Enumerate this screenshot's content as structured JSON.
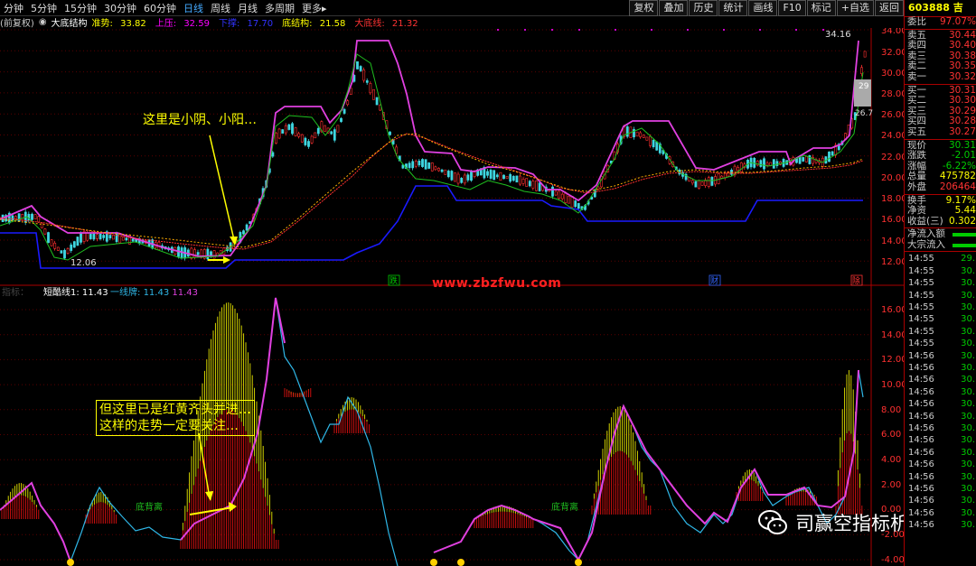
{
  "toolbar": {
    "periods": [
      "分钟",
      "5分钟",
      "15分钟",
      "30分钟",
      "60分钟",
      "日线",
      "周线",
      "月线",
      "多周期",
      "更多"
    ],
    "active_period": "日线",
    "more_arrow": "▸",
    "buttons": [
      "复权",
      "叠加",
      "历史",
      "统计",
      "画线",
      "F10",
      "标记",
      "+自选",
      "返回"
    ]
  },
  "indicator_line": {
    "prefix": "(前复权)",
    "name": "大底结构",
    "items": [
      {
        "label": "准势:",
        "value": "33.82",
        "color": "#ff0"
      },
      {
        "label": "上压:",
        "value": "32.59",
        "color": "#f0f"
      },
      {
        "label": "下撑:",
        "value": "17.70",
        "color": "#33f"
      },
      {
        "label": "底结构:",
        "value": "21.58",
        "color": "#ff0"
      },
      {
        "label": "大底线:",
        "value": "21.32",
        "color": "#f33"
      }
    ]
  },
  "sub_indicator": {
    "prefix": "指标：",
    "label1": "短酷线1:",
    "value1": "11.43",
    "label2": "一线牌:",
    "value2": "11.43",
    "value3": "11.43"
  },
  "main_chart": {
    "y_ticks": [
      "34.00",
      "32.00",
      "30.00",
      "28.00",
      "26.00",
      "24.00",
      "22.00",
      "20.00",
      "18.00",
      "16.00",
      "14.00",
      "12.00"
    ],
    "high_label": "34.16",
    "low_label": "12.06",
    "right_labels": [
      "29",
      "26.7"
    ],
    "event_markers": [
      {
        "text": "跌",
        "color": "#0c0"
      },
      {
        "text": "财",
        "color": "#36f"
      },
      {
        "text": "除",
        "color": "#f33"
      }
    ]
  },
  "sub_chart": {
    "y_ticks": [
      "16.00",
      "14.00",
      "12.00",
      "10.00",
      "8.00",
      "6.00",
      "4.00",
      "2.00",
      "0.00",
      "-2.00",
      "-4.00"
    ],
    "labels": [
      "底背离",
      "底背离"
    ]
  },
  "annotations": {
    "top": "这里是小阴、小阳…",
    "bottom_line1": "但这里已是红黄齐头并进…",
    "bottom_line2": "这样的走势一定要关注…"
  },
  "watermark": "www.zbzfwu.com",
  "wechat_name": "司赢空指标析",
  "right_panel": {
    "code": "603888",
    "code_suffix": "吉",
    "weibi": {
      "label": "委比",
      "value": "97.07%"
    },
    "asks": [
      {
        "label": "卖五",
        "value": "30.44"
      },
      {
        "label": "卖四",
        "value": "30.40"
      },
      {
        "label": "卖三",
        "value": "30.38"
      },
      {
        "label": "卖二",
        "value": "30.35"
      },
      {
        "label": "卖一",
        "value": "30.32"
      }
    ],
    "bids": [
      {
        "label": "买一",
        "value": "30.31"
      },
      {
        "label": "买二",
        "value": "30.30"
      },
      {
        "label": "买三",
        "value": "30.29"
      },
      {
        "label": "买四",
        "value": "30.28"
      },
      {
        "label": "买五",
        "value": "30.27"
      }
    ],
    "stats": [
      {
        "label": "现价",
        "value": "30.31",
        "color": "#0c0"
      },
      {
        "label": "涨跌",
        "value": "-2.01",
        "color": "#0c0"
      },
      {
        "label": "涨幅",
        "value": "-6.22%",
        "color": "#0c0"
      },
      {
        "label": "总量",
        "value": "475782",
        "color": "#ff0"
      },
      {
        "label": "外盘",
        "value": "206464",
        "color": "#f33"
      }
    ],
    "stats2": [
      {
        "label": "换手",
        "value": "9.17%",
        "color": "#ff0"
      },
      {
        "label": "净资",
        "value": "5.44",
        "color": "#ff0"
      },
      {
        "label": "收益(三)",
        "value": "0.302",
        "color": "#ff0"
      }
    ],
    "flow": [
      {
        "label": "净流入额"
      },
      {
        "label": "大宗流入"
      }
    ],
    "ticks": [
      {
        "time": "14:55",
        "value": "29."
      },
      {
        "time": "14:55",
        "value": "30."
      },
      {
        "time": "14:55",
        "value": "30."
      },
      {
        "time": "14:55",
        "value": "30."
      },
      {
        "time": "14:55",
        "value": "30."
      },
      {
        "time": "14:55",
        "value": "30."
      },
      {
        "time": "14:55",
        "value": "30."
      },
      {
        "time": "14:55",
        "value": "30."
      },
      {
        "time": "14:56",
        "value": "30."
      },
      {
        "time": "14:56",
        "value": "30."
      },
      {
        "time": "14:56",
        "value": "30."
      },
      {
        "time": "14:56",
        "value": "30."
      },
      {
        "time": "14:56",
        "value": "30."
      },
      {
        "time": "14:56",
        "value": "30."
      },
      {
        "time": "14:56",
        "value": "30."
      },
      {
        "time": "14:56",
        "value": "30."
      },
      {
        "time": "14:56",
        "value": "30."
      },
      {
        "time": "14:56",
        "value": "30."
      },
      {
        "time": "14:56",
        "value": "30."
      },
      {
        "time": "14:56",
        "value": "30."
      },
      {
        "time": "14:56",
        "value": "30."
      },
      {
        "time": "14:56",
        "value": "30."
      },
      {
        "time": "14:56",
        "value": "30."
      }
    ]
  }
}
